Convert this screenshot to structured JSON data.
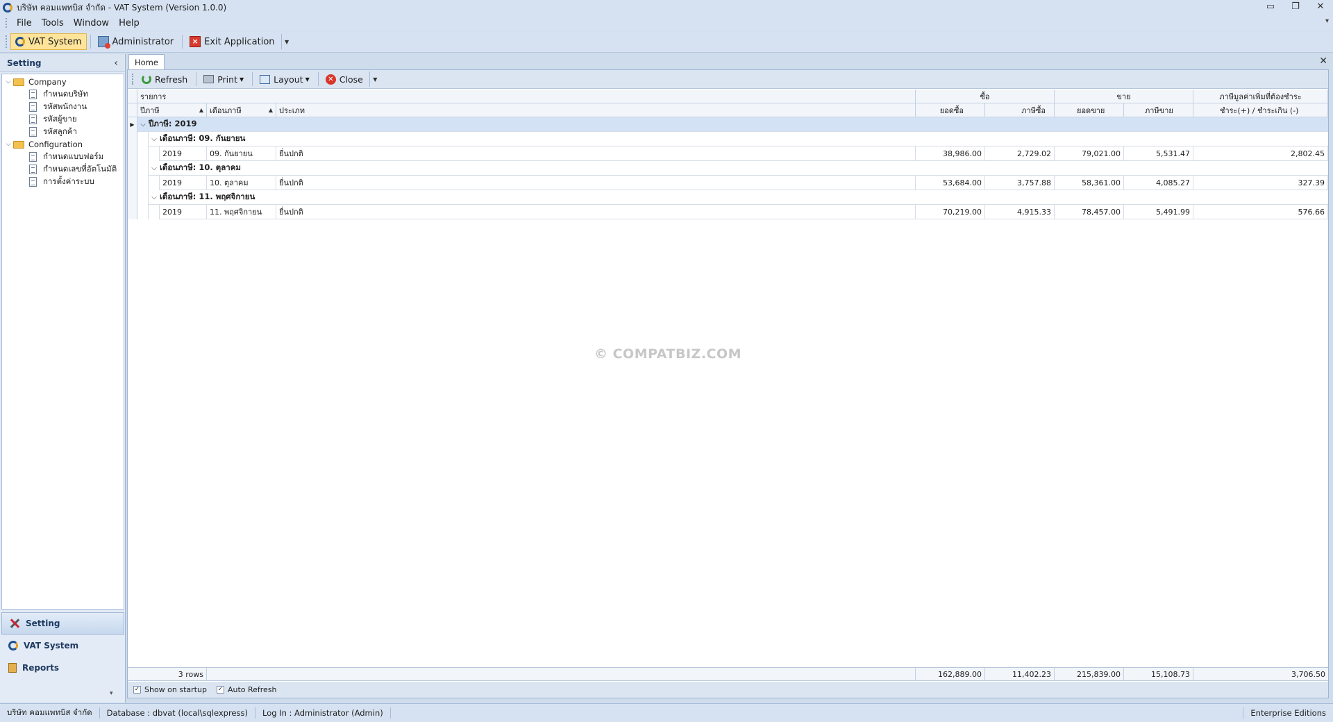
{
  "window": {
    "title": "บริษัท คอมแพทบิส จำกัด - VAT System (Version 1.0.0)",
    "controls": [
      "▭",
      "❐",
      "✕"
    ]
  },
  "menu": [
    "File",
    "Tools",
    "Window",
    "Help"
  ],
  "toolbar": {
    "vat_system": "VAT System",
    "administrator": "Administrator",
    "exit": "Exit Application"
  },
  "left_panel": {
    "title": "Setting",
    "tree": [
      {
        "label": "Company",
        "children": [
          "กำหนดบริษัท",
          "รหัสพนักงาน",
          "รหัสผู้ขาย",
          "รหัสลูกค้า"
        ]
      },
      {
        "label": "Configuration",
        "children": [
          "กำหนดแบบฟอร์ม",
          "กำหนดเลขที่อัตโนมัติ",
          "การตั้งค่าระบบ"
        ]
      }
    ],
    "nav": [
      "Setting",
      "VAT System",
      "Reports"
    ]
  },
  "doc": {
    "tab": "Home",
    "tools": {
      "refresh": "Refresh",
      "print": "Print",
      "layout": "Layout",
      "close": "Close"
    }
  },
  "grid": {
    "band_main": "รายการ",
    "band_buy": "ซื้อ",
    "band_sell": "ขาย",
    "band_vat": "ภาษีมูลค่าเพิ่มที่ต้องชำระ",
    "col_year": "ปีภาษี",
    "col_month": "เดือนภาษี",
    "col_type": "ประเภท",
    "col_buy_total": "ยอดซื้อ",
    "col_buy_tax": "ภาษีซื้อ",
    "col_sell_total": "ยอดขาย",
    "col_sell_tax": "ภาษีขาย",
    "col_vat": "ชำระ(+) / ชำระเกิน (-)",
    "year_group": "ปีภาษี: 2019",
    "groups": [
      {
        "label": "เดือนภาษี: 09. กันยายน",
        "row": [
          "2019",
          "09. กันยายน",
          "ยื่นปกติ",
          "38,986.00",
          "2,729.02",
          "79,021.00",
          "5,531.47",
          "2,802.45"
        ]
      },
      {
        "label": "เดือนภาษี: 10. ตุลาคม",
        "row": [
          "2019",
          "10. ตุลาคม",
          "ยื่นปกติ",
          "53,684.00",
          "3,757.88",
          "58,361.00",
          "4,085.27",
          "327.39"
        ]
      },
      {
        "label": "เดือนภาษี: 11. พฤศจิกายน",
        "row": [
          "2019",
          "11. พฤศจิกายน",
          "ยื่นปกติ",
          "70,219.00",
          "4,915.33",
          "78,457.00",
          "5,491.99",
          "576.66"
        ]
      }
    ],
    "footer": {
      "rows": "3 rows",
      "buy_total": "162,889.00",
      "buy_tax": "11,402.23",
      "sell_total": "215,839.00",
      "sell_tax": "15,108.73",
      "vat": "3,706.50"
    },
    "options": {
      "show_on_startup": "Show on startup",
      "auto_refresh": "Auto Refresh"
    }
  },
  "watermark": "© COMPATBIZ.COM",
  "status": {
    "company": "บริษัท คอมแพทบิส จำกัด",
    "database": "Database : dbvat (local\\sqlexpress)",
    "login": "Log In : Administrator (Admin)",
    "edition": "Enterprise Editions"
  }
}
